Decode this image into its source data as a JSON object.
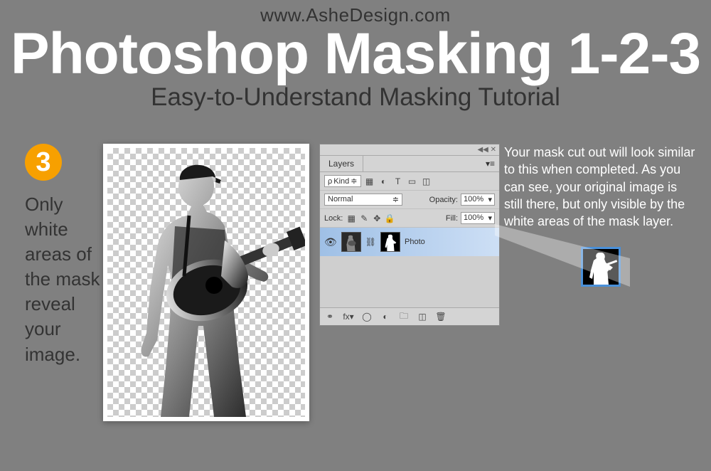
{
  "url": "www.AsheDesign.com",
  "title": "Photoshop Masking 1-2-3",
  "subtitle": "Easy-to-Understand Masking Tutorial",
  "step_number": "3",
  "left_text": "Only white areas of the mask reveal your image.",
  "right_text": "Your mask cut out will look similar to this when completed. As you can see, your original image is still there, but only visible by the white areas of the mask layer.",
  "layers_panel": {
    "tab": "Layers",
    "kind_label": "Kind",
    "kind_value": "⌕",
    "blend_mode": "Normal",
    "opacity_label": "Opacity:",
    "opacity_value": "100%",
    "lock_label": "Lock:",
    "fill_label": "Fill:",
    "fill_value": "100%",
    "layer_name": "Photo"
  }
}
